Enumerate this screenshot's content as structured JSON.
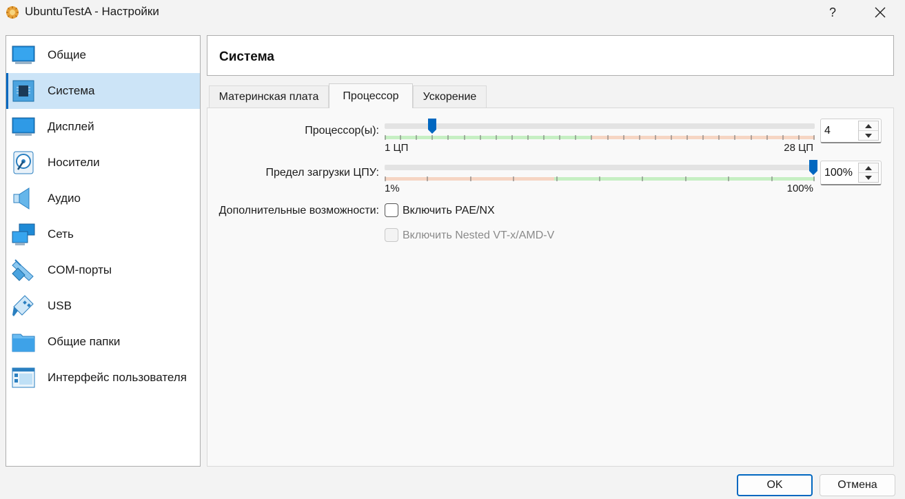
{
  "window": {
    "title": "UbuntuTestA - Настройки",
    "help_label": "?",
    "close_label": "✕"
  },
  "sidebar": {
    "items": [
      {
        "label": "Общие",
        "icon": "general-icon"
      },
      {
        "label": "Система",
        "icon": "system-chip-icon",
        "selected": true
      },
      {
        "label": "Дисплей",
        "icon": "display-icon"
      },
      {
        "label": "Носители",
        "icon": "storage-icon"
      },
      {
        "label": "Аудио",
        "icon": "audio-speaker-icon"
      },
      {
        "label": "Сеть",
        "icon": "network-icon"
      },
      {
        "label": "COM-порты",
        "icon": "serial-port-icon"
      },
      {
        "label": "USB",
        "icon": "usb-icon"
      },
      {
        "label": "Общие папки",
        "icon": "shared-folder-icon"
      },
      {
        "label": "Интерфейс пользователя",
        "icon": "user-interface-icon"
      }
    ]
  },
  "header": {
    "title": "Система"
  },
  "tabs": [
    {
      "label": "Материнская плата"
    },
    {
      "label": "Процессор",
      "active": true
    },
    {
      "label": "Ускорение"
    }
  ],
  "processor": {
    "cpu_label": "Процессор(ы):",
    "cpu_min_label": "1 ЦП",
    "cpu_max_label": "28 ЦП",
    "cpu_value": "4",
    "cpu_min": 1,
    "cpu_max": 28,
    "cpu_count": 4,
    "cpu_safe_max": 14,
    "cap_label": "Предел загрузки ЦПУ:",
    "cap_min_label": "1%",
    "cap_max_label": "100%",
    "cap_value": "100%",
    "cap_percent": 100,
    "cap_safe_min_percent": 40,
    "extended_label": "Дополнительные возможности:",
    "pae_label": "Включить PAE/NX",
    "pae_checked": false,
    "nested_label": "Включить Nested VT-x/AMD-V",
    "nested_checked": false,
    "nested_enabled": false
  },
  "colors": {
    "accent": "#0067c0",
    "safe_zone": "#c6efc3",
    "unsafe_zone": "#f6d5c3",
    "selected_bg": "#cce4f7"
  },
  "buttons": {
    "ok_label": "OK",
    "cancel_label": "Отмена"
  }
}
